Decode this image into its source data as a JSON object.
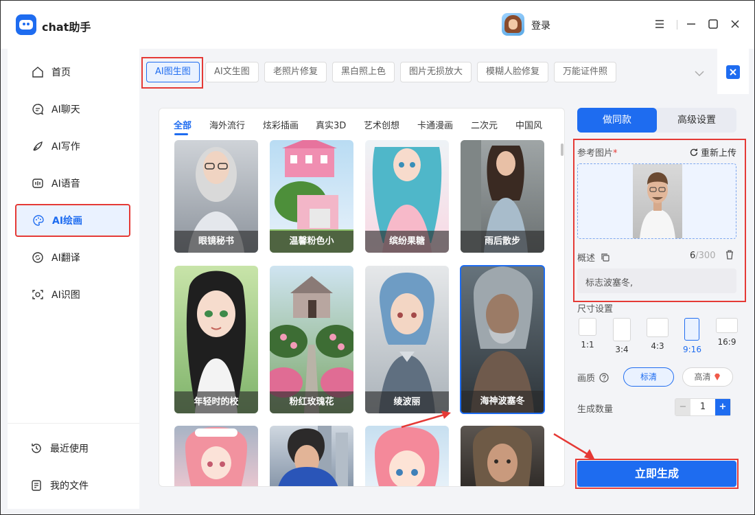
{
  "app": {
    "title": "chat助手",
    "login_label": "登录"
  },
  "sidebar": {
    "items": [
      {
        "label": "首页",
        "icon": "home-icon"
      },
      {
        "label": "AI聊天",
        "icon": "chat-icon"
      },
      {
        "label": "AI写作",
        "icon": "pen-icon"
      },
      {
        "label": "AI语音",
        "icon": "voice-icon"
      },
      {
        "label": "AI绘画",
        "icon": "palette-icon",
        "active": true
      },
      {
        "label": "AI翻译",
        "icon": "translate-icon"
      },
      {
        "label": "AI识图",
        "icon": "scan-icon"
      }
    ],
    "bottom": [
      {
        "label": "最近使用",
        "icon": "history-icon"
      },
      {
        "label": "我的文件",
        "icon": "file-icon"
      }
    ]
  },
  "top_tabs": [
    "AI图生图",
    "AI文生图",
    "老照片修复",
    "黑白照上色",
    "图片无损放大",
    "模糊人脸修复",
    "万能证件照"
  ],
  "categories": [
    "全部",
    "海外流行",
    "炫彩插画",
    "真实3D",
    "艺术创想",
    "卡通漫画",
    "二次元",
    "中国风"
  ],
  "gallery": {
    "cards": [
      {
        "caption": "眼镜秘书"
      },
      {
        "caption": "温馨粉色小"
      },
      {
        "caption": "缤纷果糖"
      },
      {
        "caption": "雨后散步"
      },
      {
        "caption": "年轻时的校"
      },
      {
        "caption": "粉红玫瑰花"
      },
      {
        "caption": "绫波丽"
      },
      {
        "caption": "海神波塞冬",
        "selected": true
      }
    ]
  },
  "panel": {
    "seg_same": "做同款",
    "seg_advanced": "高级设置",
    "ref_label": "参考图片",
    "required_mark": "*",
    "reupload": "重新上传",
    "desc_label": "概述",
    "desc_count": "6",
    "desc_max": "/300",
    "desc_text": "标志波塞冬,",
    "size_label": "尺寸设置",
    "sizes": [
      "1:1",
      "3:4",
      "4:3",
      "9:16",
      "16:9"
    ],
    "selected_size": "9:16",
    "quality_label": "画质",
    "quality_standard": "标清",
    "quality_hd": "高清",
    "count_label": "生成数量",
    "count_value": "1",
    "count_minus": "−",
    "count_plus": "+",
    "generate_label": "立即生成"
  },
  "colors": {
    "accent": "#1e6cf0",
    "annotation": "#e53935"
  }
}
